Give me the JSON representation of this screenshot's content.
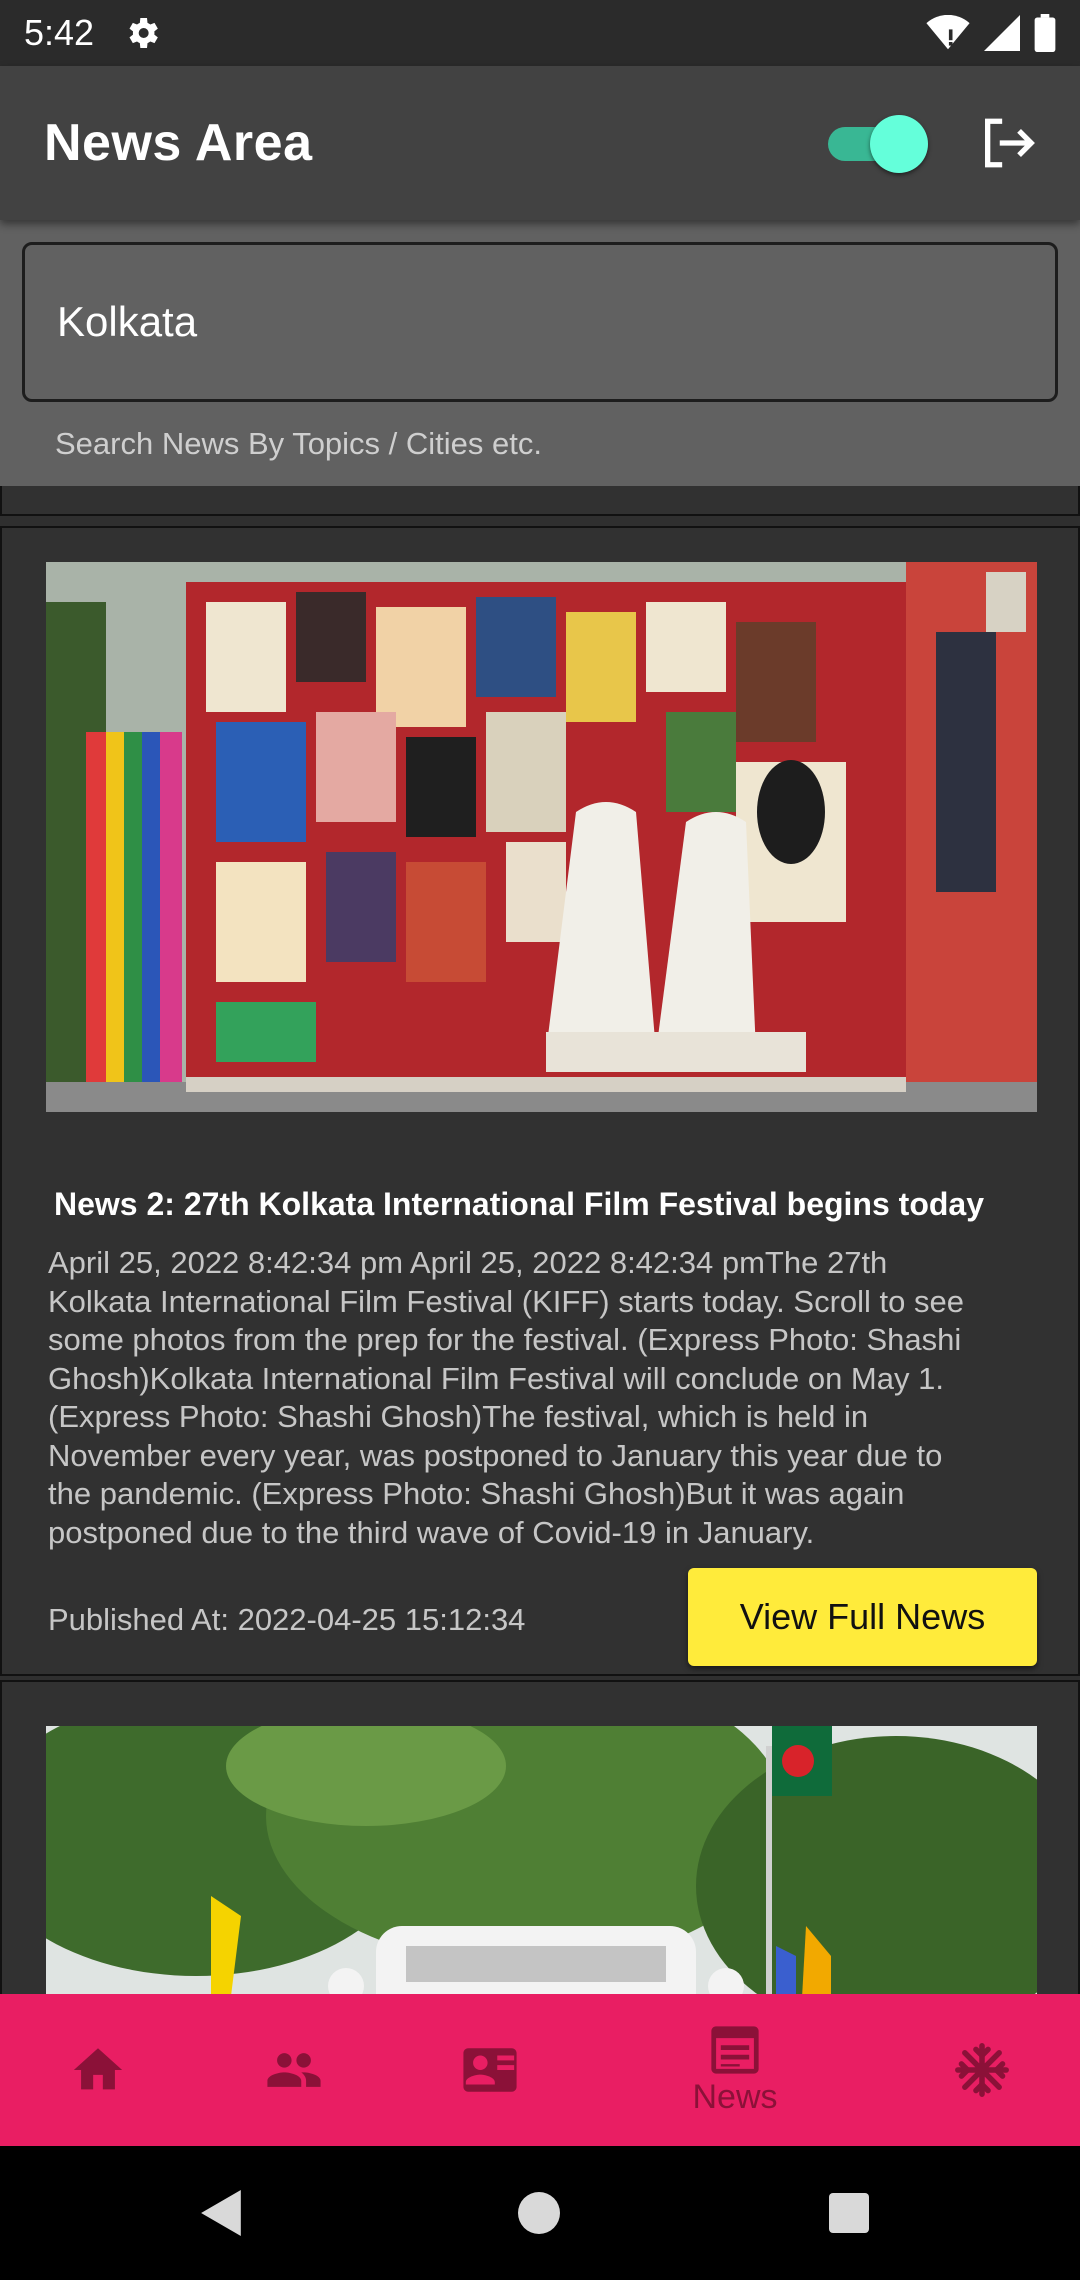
{
  "status_bar": {
    "time": "5:42",
    "icons": [
      "gear-icon",
      "wifi-icon",
      "signal-icon",
      "battery-icon"
    ]
  },
  "app_bar": {
    "title": "News Area",
    "toggle_on": true,
    "toggle_color": "#64ffda",
    "logout_icon": "logout-icon"
  },
  "search": {
    "value": "Kolkata",
    "helper": "Search News By Topics / Cities etc."
  },
  "news": [
    {
      "image_icon": "film-festival-photo",
      "title": "News 2: 27th Kolkata International Film Festival begins today",
      "body_lines": [
        "April 25, 2022 8:42:34 pm April 25, 2022 8:42:34 pmThe 27th",
        "Kolkata International Film Festival (KIFF) starts today. Scroll to see",
        "some photos from the prep for the festival. (Express Photo: Shashi",
        "Ghosh)Kolkata International Film Festival will conclude on May 1.",
        "(Express Photo: Shashi Ghosh)The festival, which is held in",
        "November every year, was postponed to January this year due to",
        "the pandemic. (Express Photo: Shashi Ghosh)But it was again",
        "postponed due to the third wave of Covid-19 in January."
      ],
      "published": "Published At: 2022-04-25 15:12:34",
      "button_label": "View Full News",
      "button_color": "#ffeb3b"
    },
    {
      "image_icon": "flag-street-photo"
    }
  ],
  "bottom_nav": {
    "background": "#e91e63",
    "items": [
      {
        "icon": "home-icon",
        "label": ""
      },
      {
        "icon": "people-icon",
        "label": ""
      },
      {
        "icon": "contact-card-icon",
        "label": ""
      },
      {
        "icon": "news-icon",
        "label": "News",
        "selected": true
      },
      {
        "icon": "snowflake-icon",
        "label": ""
      }
    ]
  },
  "system_nav": {
    "icons": [
      "back-icon",
      "home-circle-icon",
      "recents-icon"
    ]
  }
}
